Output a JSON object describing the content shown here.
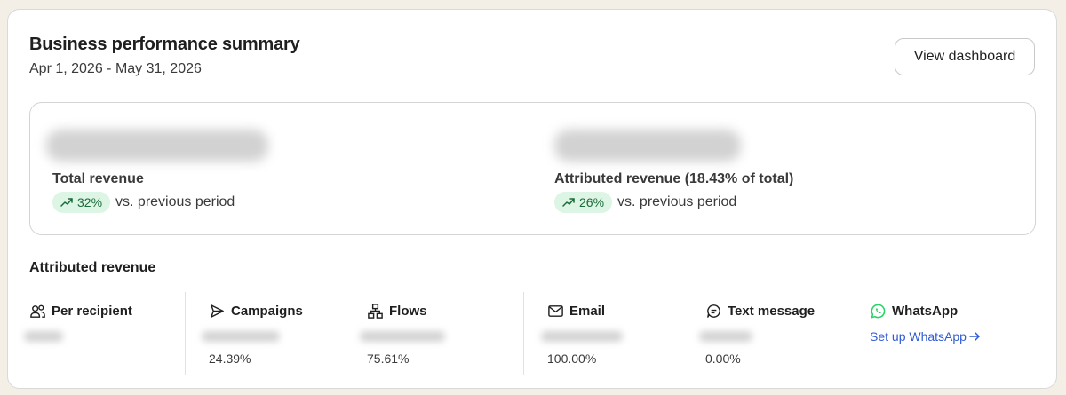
{
  "header": {
    "title": "Business performance summary",
    "date_range": "Apr 1, 2026 - May 31, 2026",
    "view_dashboard_label": "View dashboard"
  },
  "summary": {
    "total_revenue": {
      "label": "Total revenue",
      "change": "32%",
      "comparison": "vs. previous period"
    },
    "attributed_revenue": {
      "label": "Attributed revenue (18.43% of total)",
      "change": "26%",
      "comparison": "vs. previous period"
    }
  },
  "breakdown": {
    "title": "Attributed revenue",
    "columns": [
      {
        "label": "Per recipient",
        "icon": "users-icon",
        "percent": ""
      },
      {
        "label": "Campaigns",
        "icon": "send-icon",
        "percent": "24.39%"
      },
      {
        "label": "Flows",
        "icon": "flow-icon",
        "percent": "75.61%"
      },
      {
        "label": "Email",
        "icon": "mail-icon",
        "percent": "100.00%"
      },
      {
        "label": "Text message",
        "icon": "message-icon",
        "percent": "0.00%"
      },
      {
        "label": "WhatsApp",
        "icon": "whatsapp-icon",
        "percent": ""
      }
    ],
    "whatsapp_setup_link": "Set up WhatsApp"
  },
  "colors": {
    "positive_badge_bg": "#dcf5e4",
    "positive_badge_text": "#1d6b3a",
    "link": "#2f5bd3",
    "whatsapp": "#25d366"
  }
}
